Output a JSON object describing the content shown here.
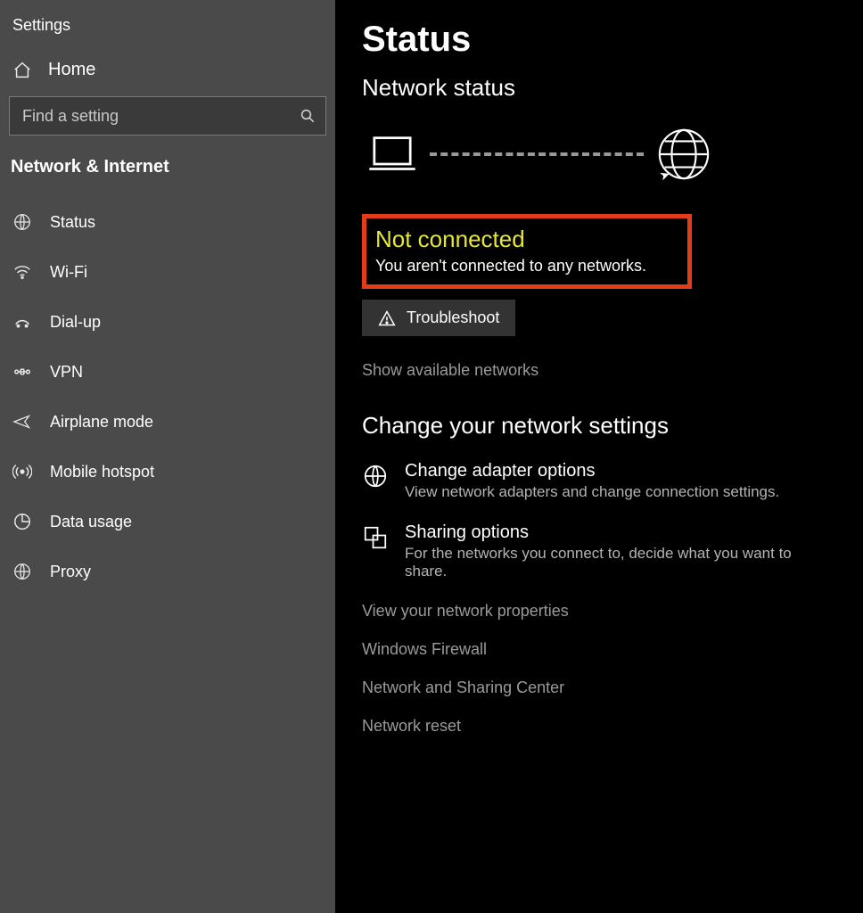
{
  "app_title": "Settings",
  "sidebar": {
    "home_label": "Home",
    "search_placeholder": "Find a setting",
    "category": "Network & Internet",
    "items": [
      {
        "icon": "globe",
        "label": "Status"
      },
      {
        "icon": "wifi",
        "label": "Wi-Fi"
      },
      {
        "icon": "dialup",
        "label": "Dial-up"
      },
      {
        "icon": "vpn",
        "label": "VPN"
      },
      {
        "icon": "airplane",
        "label": "Airplane mode"
      },
      {
        "icon": "hotspot",
        "label": "Mobile hotspot"
      },
      {
        "icon": "data",
        "label": "Data usage"
      },
      {
        "icon": "proxy",
        "label": "Proxy"
      }
    ]
  },
  "main": {
    "title": "Status",
    "section1": "Network status",
    "alert_title": "Not connected",
    "alert_sub": "You aren't connected to any networks.",
    "troubleshoot": "Troubleshoot",
    "show_networks": "Show available networks",
    "section2": "Change your network settings",
    "adapter_label": "Change adapter options",
    "adapter_desc": "View network adapters and change connection settings.",
    "sharing_label": "Sharing options",
    "sharing_desc": "For the networks you connect to, decide what you want to share.",
    "links": [
      "View your network properties",
      "Windows Firewall",
      "Network and Sharing Center",
      "Network reset"
    ]
  }
}
